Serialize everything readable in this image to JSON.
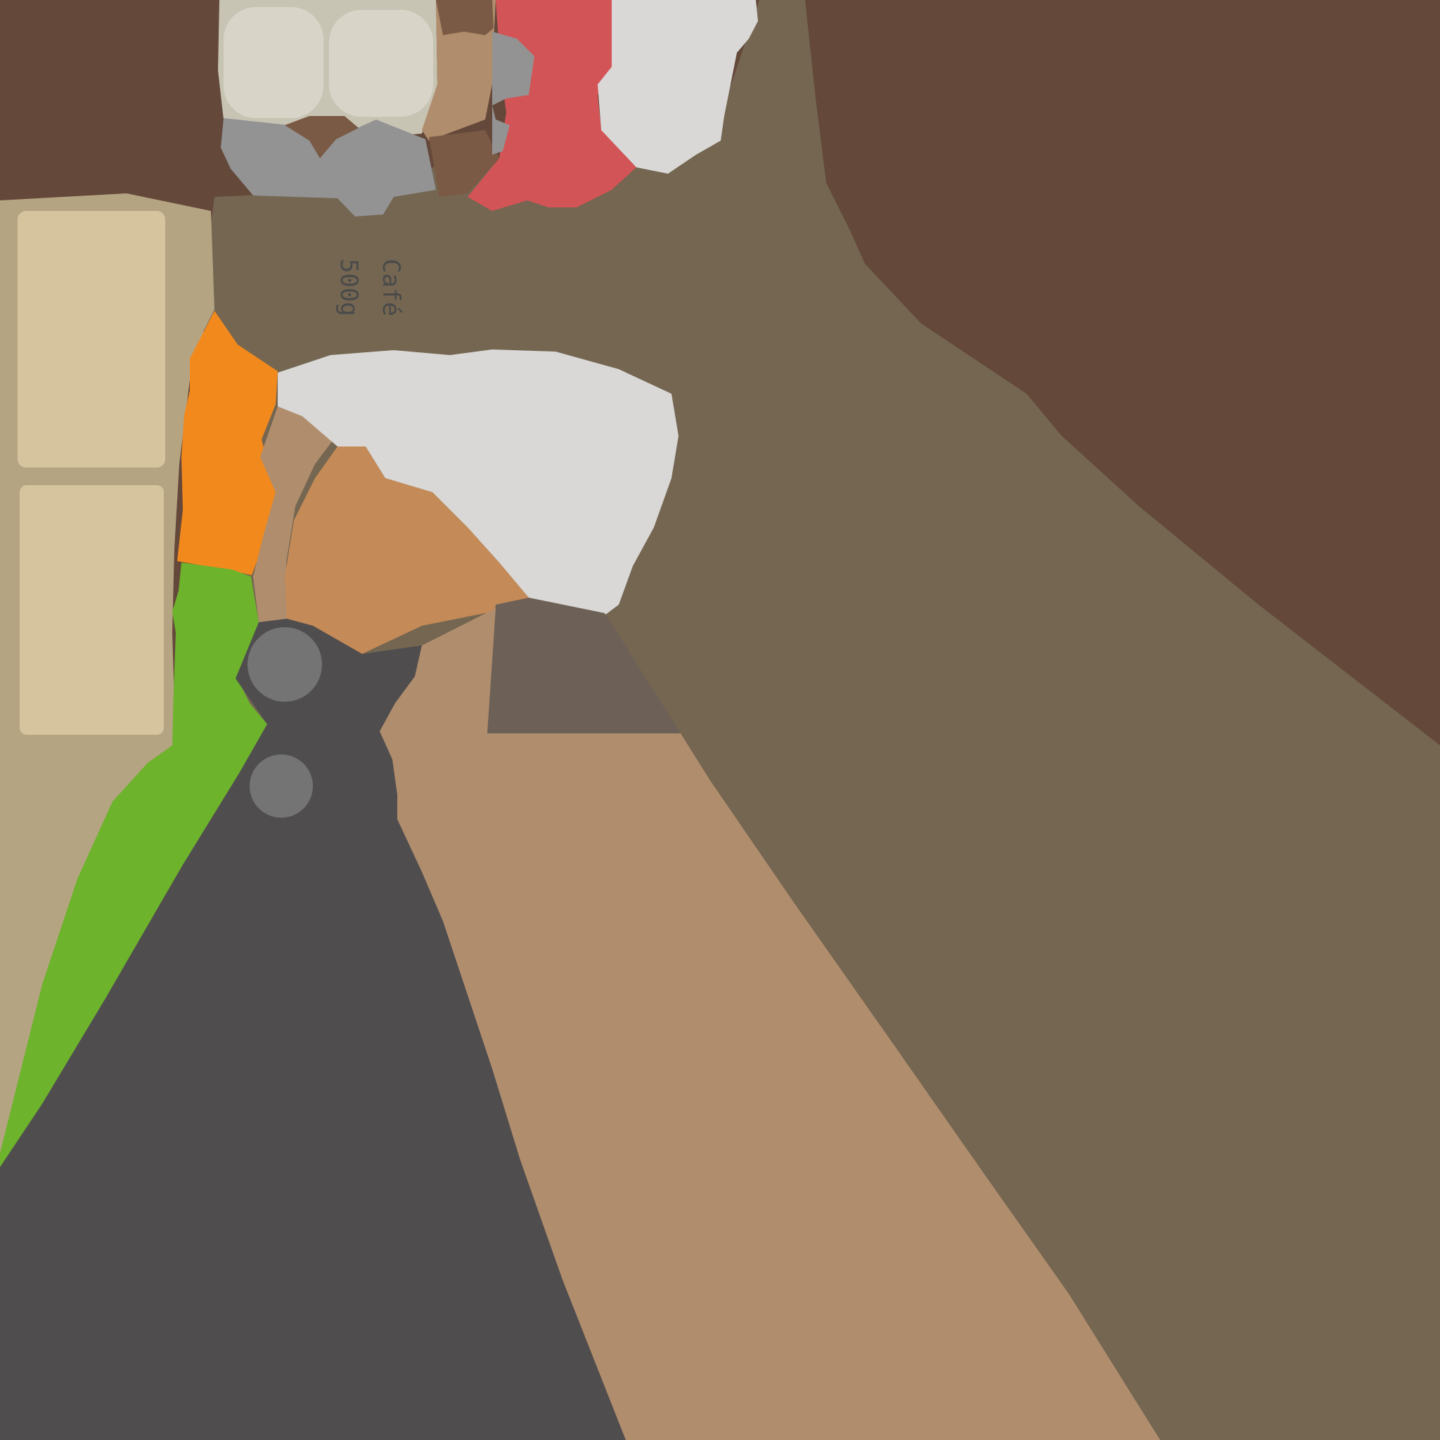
{
  "package_label": {
    "line1": "Café",
    "line2": "500g"
  },
  "colors": {
    "background_wall": "#64483a",
    "shelf": "#746651",
    "cardboard_box": "#b5a482",
    "cardboard_panel": "#d5c49e",
    "dark_gray_item": "#4f4d4e",
    "tan_item": "#b08d6d",
    "orange_item": "#f2891d",
    "green_item": "#6db32c",
    "white_item": "#d9d8d6",
    "caramel_item": "#c48a57",
    "red_item": "#d35456",
    "light_gray": "#939393",
    "egg_cream": "#d8d4c8",
    "dark_brown": "#7a5a44",
    "knob_gray": "#747474",
    "block_taupe": "#6d6056"
  }
}
